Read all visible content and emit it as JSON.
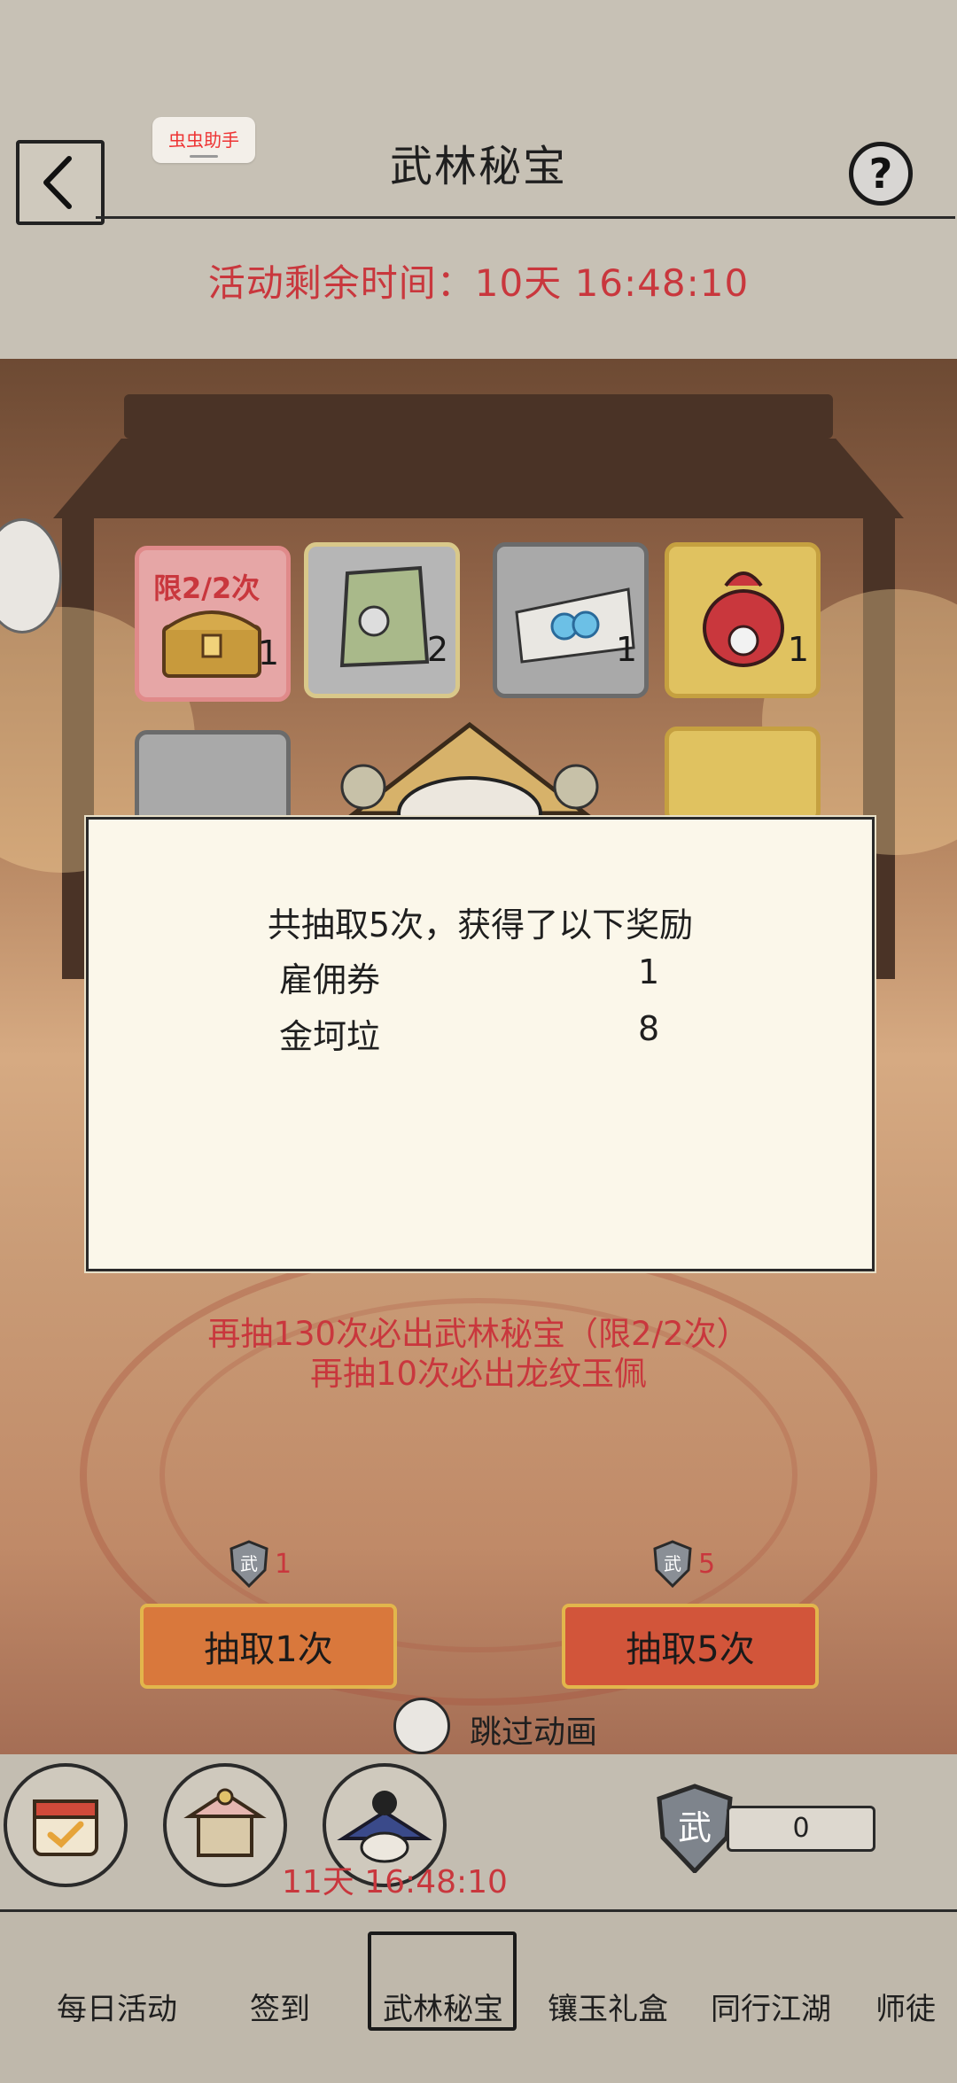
{
  "header": {
    "helper_badge": "虫虫助手",
    "title": "武林秘宝",
    "help_symbol": "?",
    "countdown": "活动剩余时间：10天 16:48:10"
  },
  "prize_grid": {
    "tiles": [
      {
        "tag": "限2/2次",
        "count": "1"
      },
      {
        "count": "2"
      },
      {
        "count": "1"
      },
      {
        "count": "1"
      }
    ]
  },
  "dialog": {
    "title": "共抽取5次，获得了以下奖励",
    "rewards": [
      {
        "name": "雇佣券",
        "qty": "1"
      },
      {
        "name": "金坷垃",
        "qty": "8"
      }
    ]
  },
  "pity": {
    "line1": "再抽130次必出武林秘宝（限2/2次）",
    "line2": "再抽10次必出龙纹玉佩"
  },
  "draw": {
    "single_cost": "1",
    "single_label": "抽取1次",
    "multi_cost": "5",
    "multi_label": "抽取5次",
    "skip_label": "跳过动画"
  },
  "bottom": {
    "timer": "11天 16:48:10",
    "currency_value": "0",
    "shield_glyph": "武"
  },
  "tabs": [
    "每日活动",
    "签到",
    "武林秘宝",
    "镶玉礼盒",
    "同行江湖",
    "师徒"
  ],
  "colors": {
    "accent_red": "#c9373d",
    "btn_orange": "#d9783c",
    "btn_red": "#d2553a"
  }
}
